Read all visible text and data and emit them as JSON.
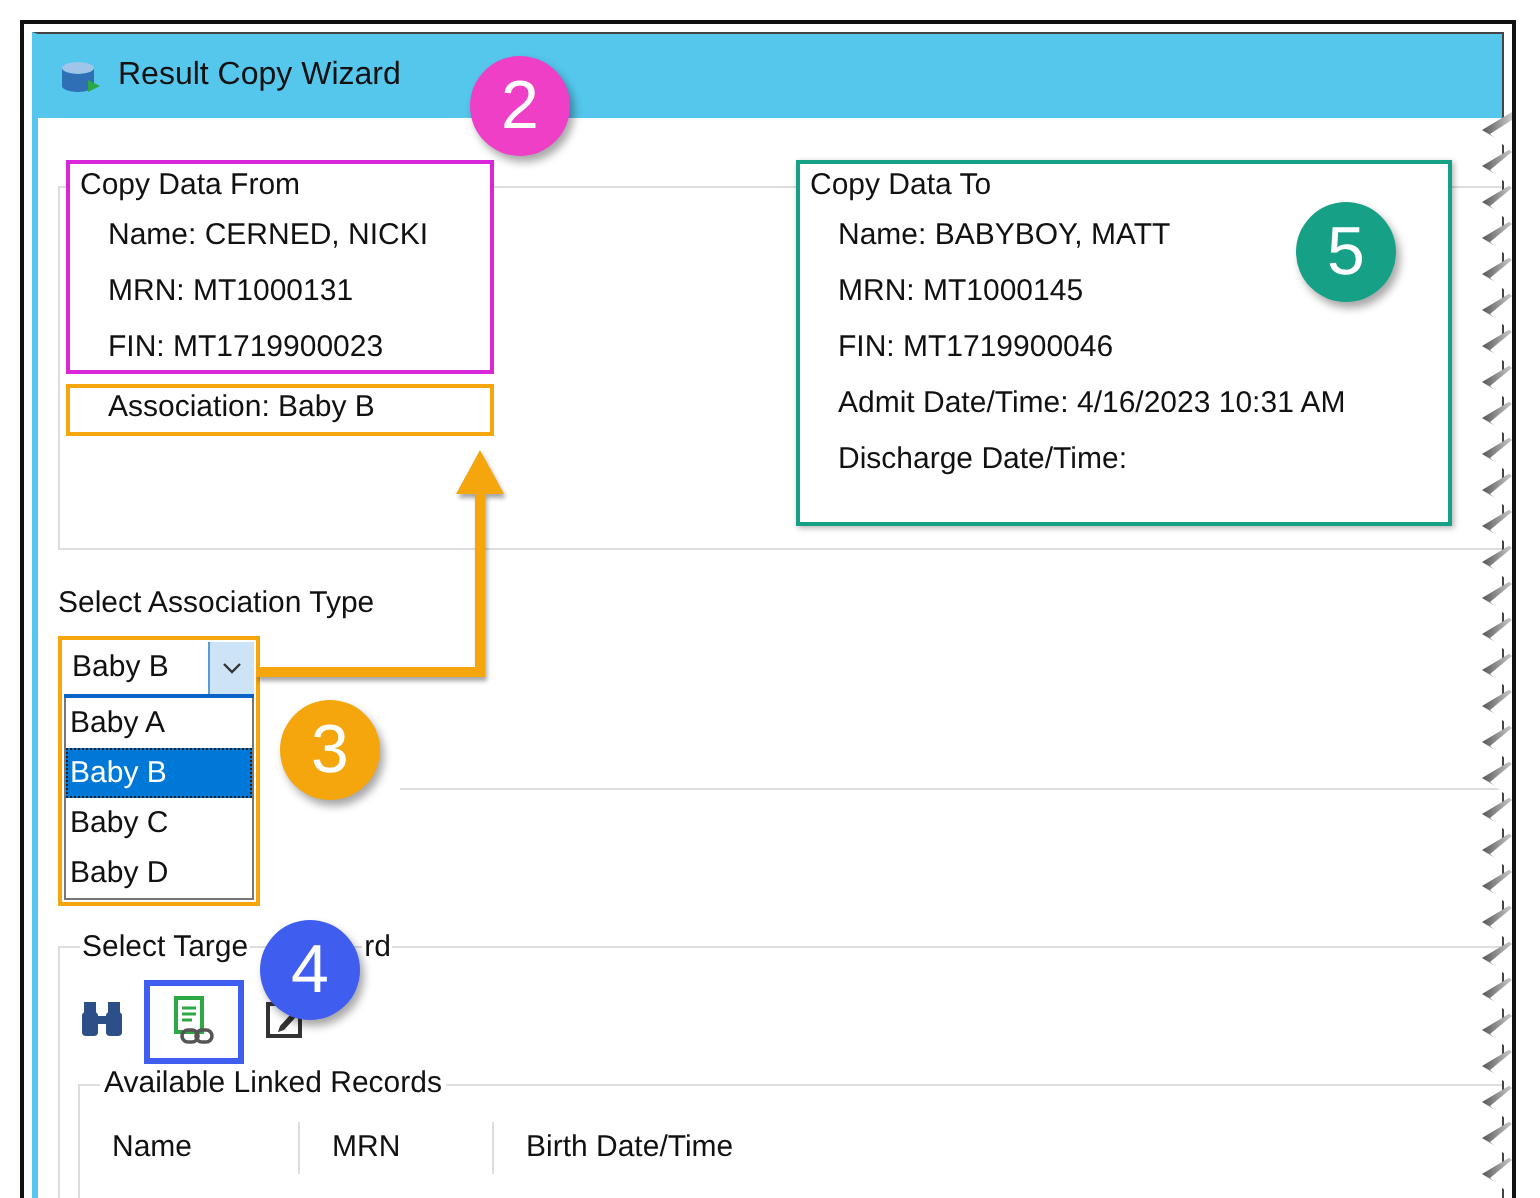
{
  "window": {
    "title": "Result Copy Wizard"
  },
  "copy_from": {
    "legend": "Copy Data From",
    "fields": [
      "Name: CERNED, NICKI",
      "MRN: MT1000131",
      "FIN: MT1719900023"
    ],
    "association": "Association: Baby B"
  },
  "copy_to": {
    "legend": "Copy Data To",
    "fields": [
      "Name: BABYBOY, MATT",
      "MRN: MT1000145",
      "FIN: MT1719900046",
      "Admit Date/Time: 4/16/2023 10:31 AM",
      "Discharge Date/Time:"
    ]
  },
  "association_type": {
    "label": "Select Association Type",
    "value": "Baby B",
    "options": [
      {
        "label": "Baby A",
        "selected": false
      },
      {
        "label": "Baby B",
        "selected": true
      },
      {
        "label": "Baby C",
        "selected": false
      },
      {
        "label": "Baby D",
        "selected": false
      }
    ]
  },
  "target_record": {
    "legend_parts": [
      "Select Targe",
      "rd"
    ],
    "linked_records": {
      "legend": "Available Linked Records",
      "columns": [
        "Name",
        "MRN",
        "Birth Date/Time"
      ]
    }
  },
  "callouts": [
    {
      "label": "2",
      "color": "#ee3fc6"
    },
    {
      "label": "3",
      "color": "#f4a60c"
    },
    {
      "label": "4",
      "color": "#3f5ef0"
    },
    {
      "label": "5",
      "color": "#16a086"
    }
  ]
}
